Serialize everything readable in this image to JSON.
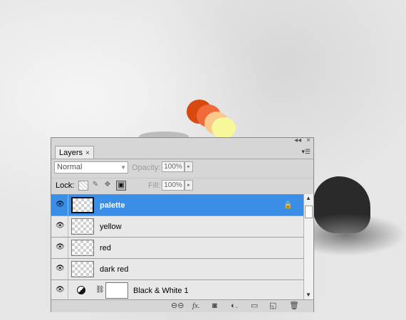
{
  "panel": {
    "tab_label": "Layers",
    "tab_close": "×",
    "collapse_glyph": "◂◂",
    "close_glyph": "×",
    "menu_glyph": "▾☰"
  },
  "blend": {
    "mode": "Normal",
    "opacity_label": "Opacity:",
    "opacity_value": "100%",
    "fill_label": "Fill:",
    "fill_value": "100%"
  },
  "lock": {
    "label": "Lock:"
  },
  "layers": [
    {
      "name": "palette",
      "selected": true,
      "locked": true,
      "visible": true
    },
    {
      "name": "yellow",
      "selected": false,
      "locked": false,
      "visible": true
    },
    {
      "name": "red",
      "selected": false,
      "locked": false,
      "visible": true
    },
    {
      "name": "dark red",
      "selected": false,
      "locked": false,
      "visible": true
    },
    {
      "name": "Black & White 1",
      "type": "adjustment",
      "visible": true
    }
  ],
  "colors": {
    "selected_row": "#3a8ee6",
    "swatch_dark_orange": "#d9480f",
    "swatch_orange": "#f06a3a",
    "swatch_peach": "#f8c98a",
    "swatch_yellow": "#f8f89a"
  },
  "icons": {
    "eye": "eye-icon",
    "lock": "lock-icon",
    "link_layers": "link-layers-icon",
    "layer_style": "fx-icon",
    "mask": "add-mask-icon",
    "adjustment": "adjustment-layer-icon",
    "group": "folder-icon",
    "new_layer": "new-layer-icon",
    "delete": "trash-icon"
  }
}
